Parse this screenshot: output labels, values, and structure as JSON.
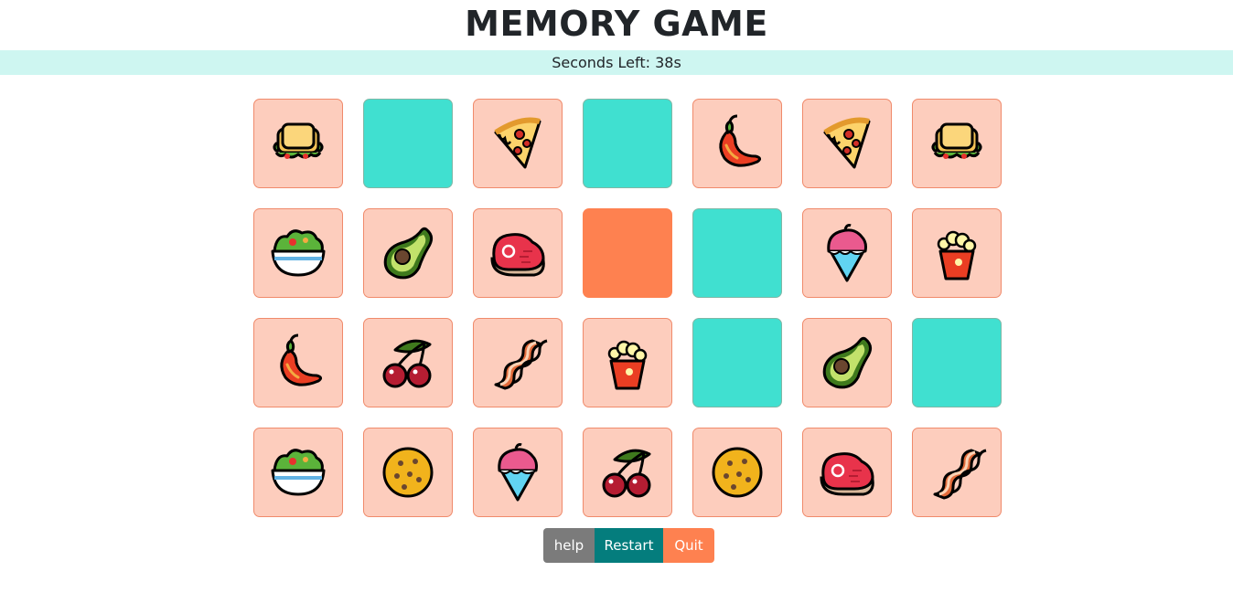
{
  "game": {
    "title": "MEMORY GAME",
    "timer_text": "Seconds Left: 38s"
  },
  "colors": {
    "card_face": "#fdcdbd",
    "card_back": "#40e0d0",
    "card_selected": "#fe8150",
    "timer_bar": "#cef6f1"
  },
  "board": {
    "rows": 4,
    "cols": 7,
    "cards": [
      {
        "state": "face-up",
        "food": "sandwich"
      },
      {
        "state": "face-down",
        "food": ""
      },
      {
        "state": "face-up",
        "food": "pizza"
      },
      {
        "state": "face-down",
        "food": ""
      },
      {
        "state": "face-up",
        "food": "hot-pepper"
      },
      {
        "state": "face-up",
        "food": "pizza"
      },
      {
        "state": "face-up",
        "food": "sandwich"
      },
      {
        "state": "face-up",
        "food": "salad"
      },
      {
        "state": "face-up",
        "food": "avocado"
      },
      {
        "state": "face-up",
        "food": "steak"
      },
      {
        "state": "selected",
        "food": ""
      },
      {
        "state": "face-down",
        "food": ""
      },
      {
        "state": "face-up",
        "food": "shaved-ice"
      },
      {
        "state": "face-up",
        "food": "popcorn"
      },
      {
        "state": "face-up",
        "food": "hot-pepper"
      },
      {
        "state": "face-up",
        "food": "cherries"
      },
      {
        "state": "face-up",
        "food": "bacon"
      },
      {
        "state": "face-up",
        "food": "popcorn"
      },
      {
        "state": "face-down",
        "food": ""
      },
      {
        "state": "face-up",
        "food": "avocado"
      },
      {
        "state": "face-down",
        "food": ""
      },
      {
        "state": "face-up",
        "food": "salad"
      },
      {
        "state": "face-up",
        "food": "cookie"
      },
      {
        "state": "face-up",
        "food": "shaved-ice"
      },
      {
        "state": "face-up",
        "food": "cherries"
      },
      {
        "state": "face-up",
        "food": "cookie"
      },
      {
        "state": "face-up",
        "food": "steak"
      },
      {
        "state": "face-up",
        "food": "bacon"
      }
    ]
  },
  "controls": {
    "help_label": "help",
    "restart_label": "Restart",
    "quit_label": "Quit"
  }
}
